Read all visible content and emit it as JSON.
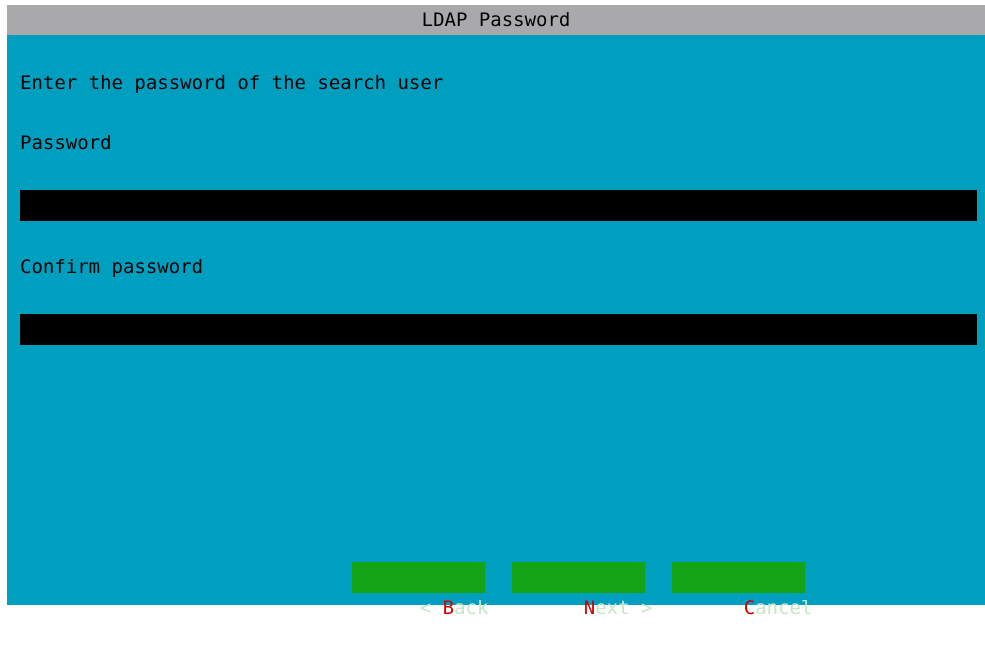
{
  "window": {
    "title": "LDAP Password"
  },
  "prompt": "Enter the password of the search user",
  "fields": {
    "password": {
      "label": "Password",
      "value": ""
    },
    "confirm": {
      "label": "Confirm password",
      "value": ""
    }
  },
  "buttons": {
    "back": {
      "prefix": "< ",
      "hotkey": "B",
      "rest": "ack"
    },
    "next": {
      "prefix": "",
      "hotkey": "N",
      "rest": "ext >"
    },
    "cancel": {
      "prefix": "",
      "hotkey": "C",
      "rest": "ancel"
    }
  },
  "colors": {
    "dialog_background": "#009fbf",
    "titlebar": "#a9a9ab",
    "button": "#14a314",
    "hotkey": "#d20000"
  }
}
